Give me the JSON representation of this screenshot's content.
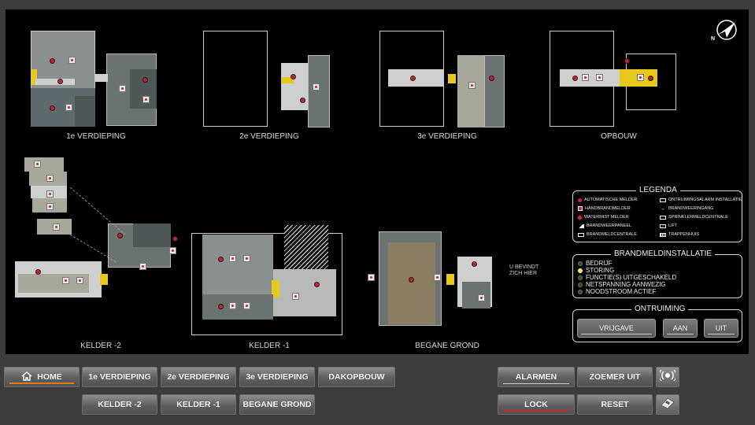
{
  "floors": {
    "f1": "1e VERDIEPING",
    "f2": "2e VERDIEPING",
    "f3": "3e VERDIEPING",
    "opbouw": "OPBOUW",
    "k2": "KELDER -2",
    "k1": "KELDER -1",
    "bg": "BEGANE GROND"
  },
  "you_are_here": {
    "line1": "U BEVINDT",
    "line2": "ZICH HIER"
  },
  "legenda": {
    "title": "LEGENDA",
    "left": [
      {
        "label": "AUTOMATISCHE MELDER",
        "icon": "red-dot-icon"
      },
      {
        "label": "HANDBRANDMELDER",
        "icon": "manual-call-point-icon"
      },
      {
        "label": "WATERMIST MELDER",
        "icon": "water-mist-icon"
      },
      {
        "label": "BRANDWEERPANEEL",
        "icon": "fire-panel-icon"
      },
      {
        "label": "BRANDMELDCENTRALE",
        "icon": "fire-control-icon"
      }
    ],
    "right": [
      {
        "label": "ONTRUIMINGSALARM INSTALLATIE",
        "icon": "evacuation-alarm-icon"
      },
      {
        "label": "BRANDWEERINGANG",
        "icon": "arrow-right-icon"
      },
      {
        "label": "SPRINKLERMELDCENTRALE",
        "icon": "sprinkler-icon"
      },
      {
        "label": "LIFT",
        "icon": "lift-icon"
      },
      {
        "label": "TRAPPENHUIS",
        "icon": "stairs-icon"
      }
    ]
  },
  "brandmeld": {
    "title": "BRANDMELDINSTALLATIE",
    "items": [
      {
        "label": "BEDRIJF",
        "active": false
      },
      {
        "label": "STORING",
        "active": true
      },
      {
        "label": "FUNCTIE(S) UITGESCHAKELD",
        "active": false
      },
      {
        "label": "NETSPANNING AANWEZIG",
        "active": false
      },
      {
        "label": "NOODSTROOM ACTIEF",
        "active": false
      }
    ]
  },
  "ontruiming": {
    "title": "ONTRUIMING",
    "vrijgave": "VRIJGAVE",
    "aan": "AAN",
    "uit": "UIT"
  },
  "nav": {
    "home": "HOME",
    "v1": "1e VERDIEPING",
    "v2": "2e VERDIEPING",
    "v3": "3e VERDIEPING",
    "dak": "DAKOPBOUW",
    "k2": "KELDER -2",
    "k1": "KELDER -1",
    "bg": "BEGANE GROND",
    "alarmen": "ALARMEN",
    "zoemer": "ZOEMER UIT",
    "lock": "LOCK",
    "reset": "RESET"
  },
  "north_label": "N",
  "colors": {
    "accent_orange": "#e07b1a",
    "accent_red": "#d2262a",
    "status_active": "#f3e73a",
    "zone_yellow": "#e8c81a"
  }
}
